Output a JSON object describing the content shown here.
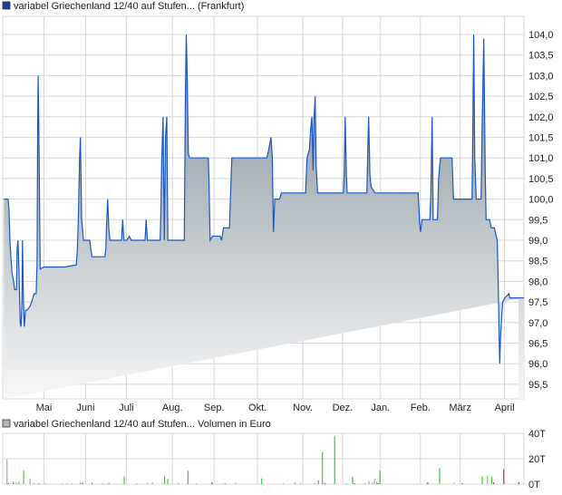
{
  "price_legend": "variabel Griechenland 12/40 auf Stufen... (Frankfurt)",
  "volume_legend": "variabel Griechenland 12/40 auf Stufen... Volumen in Euro",
  "colors": {
    "line": "#1a56c4",
    "fill_top": "#7f8c94",
    "fill_bottom": "#f6f7f8",
    "grid": "#d8d8d8",
    "up": "#33cc33",
    "down": "#e03030",
    "neutral": "#aaaaaa",
    "legend_price": "#1a3c9c",
    "legend_volume": "#b8b8b8"
  },
  "chart_data": [
    {
      "type": "area",
      "title": "variabel Griechenland 12/40 auf Stufen... (Frankfurt)",
      "xunit": "days since start",
      "xlim": [
        0,
        379
      ],
      "ylim": [
        95.1,
        104.45
      ],
      "yticks": [
        "95,5",
        "96,0",
        "96,5",
        "97,0",
        "97,5",
        "98,0",
        "98,5",
        "99,0",
        "99,5",
        "100,0",
        "100,5",
        "101,0",
        "101,5",
        "102,0",
        "102,5",
        "103,0",
        "103,5",
        "104,0"
      ],
      "ytick_values": [
        95.5,
        96,
        96.5,
        97,
        97.5,
        98,
        98.5,
        99,
        99.5,
        100,
        100.5,
        101,
        101.5,
        102,
        102.5,
        103,
        103.5,
        104
      ],
      "months": [
        {
          "label": "Mai",
          "day": 30
        },
        {
          "label": "Juni",
          "day": 60.3
        },
        {
          "label": "Juli",
          "day": 89.9
        },
        {
          "label": "Aug.",
          "day": 123.4
        },
        {
          "label": "Sep.",
          "day": 153.7
        },
        {
          "label": "Okt.",
          "day": 185.3
        },
        {
          "label": "Nov.",
          "day": 218.2
        },
        {
          "label": "Dez.",
          "day": 247.1
        },
        {
          "label": "Jan.",
          "day": 274.7
        },
        {
          "label": "Feb.",
          "day": 303.7
        },
        {
          "label": "März",
          "day": 332.6
        },
        {
          "label": "April",
          "day": 364.9
        }
      ],
      "points": [
        [
          0.8,
          100.0
        ],
        [
          3.9,
          100.0
        ],
        [
          4.6,
          99.7
        ],
        [
          5.2,
          99.0
        ],
        [
          6.1,
          98.5
        ],
        [
          6.8,
          98.2
        ],
        [
          7.9,
          98.0
        ],
        [
          8.7,
          97.8
        ],
        [
          10.0,
          97.8
        ],
        [
          10.5,
          98.8
        ],
        [
          11.1,
          99.0
        ],
        [
          11.8,
          98.3
        ],
        [
          12.7,
          97.0
        ],
        [
          13.3,
          96.9
        ],
        [
          14.0,
          97.5
        ],
        [
          14.4,
          99.0
        ],
        [
          15.1,
          97.5
        ],
        [
          15.7,
          96.9
        ],
        [
          16.6,
          97.3
        ],
        [
          17.7,
          97.3
        ],
        [
          19.9,
          97.4
        ],
        [
          21.0,
          97.5
        ],
        [
          22.8,
          97.7
        ],
        [
          24.3,
          97.7
        ],
        [
          25.0,
          98.5
        ],
        [
          25.4,
          101.5
        ],
        [
          25.8,
          103.0
        ],
        [
          26.5,
          101.0
        ],
        [
          27.2,
          98.3
        ],
        [
          29.8,
          98.35
        ],
        [
          45.1,
          98.35
        ],
        [
          53.5,
          98.4
        ],
        [
          54.3,
          98.8
        ],
        [
          55.2,
          99.8
        ],
        [
          55.9,
          101.0
        ],
        [
          56.5,
          101.5
        ],
        [
          57.4,
          99.5
        ],
        [
          58.7,
          99.0
        ],
        [
          63.3,
          99.0
        ],
        [
          64.0,
          98.8
        ],
        [
          64.9,
          98.6
        ],
        [
          74.3,
          98.6
        ],
        [
          75.0,
          98.8
        ],
        [
          75.4,
          99.3
        ],
        [
          76.3,
          100.0
        ],
        [
          77.1,
          99.3
        ],
        [
          78.0,
          99.0
        ],
        [
          86.4,
          99.0
        ],
        [
          87.2,
          99.5
        ],
        [
          88.1,
          99.0
        ],
        [
          90.3,
          99.0
        ],
        [
          92.1,
          99.1
        ],
        [
          93.4,
          99.0
        ],
        [
          103.5,
          99.0
        ],
        [
          104.3,
          99.5
        ],
        [
          105.2,
          99.0
        ],
        [
          114.4,
          99.0
        ],
        [
          114.9,
          99.5
        ],
        [
          115.7,
          101.0
        ],
        [
          116.6,
          102.0
        ],
        [
          117.5,
          99.0
        ],
        [
          118.4,
          101.5
        ],
        [
          119.3,
          102.0
        ],
        [
          120.1,
          99.0
        ],
        [
          132.0,
          99.0
        ],
        [
          132.9,
          102.7
        ],
        [
          133.5,
          104.0
        ],
        [
          134.2,
          102.9
        ],
        [
          135.0,
          101.1
        ],
        [
          135.9,
          101.0
        ],
        [
          149.5,
          101.0
        ],
        [
          150.0,
          100.4
        ],
        [
          150.8,
          99.0
        ],
        [
          152.6,
          99.1
        ],
        [
          158.1,
          99.1
        ],
        [
          159.2,
          99.0
        ],
        [
          160.5,
          99.3
        ],
        [
          161.8,
          99.3
        ],
        [
          164.9,
          99.3
        ],
        [
          165.3,
          99.8
        ],
        [
          166.6,
          101.0
        ],
        [
          192.1,
          101.0
        ],
        [
          193.4,
          101.2
        ],
        [
          195.1,
          101.5
        ],
        [
          196.0,
          101.0
        ],
        [
          196.5,
          100.0
        ],
        [
          196.9,
          99.2
        ],
        [
          197.8,
          100.0
        ],
        [
          201.3,
          100.0
        ],
        [
          202.6,
          100.15
        ],
        [
          220.2,
          100.15
        ],
        [
          221.3,
          101.0
        ],
        [
          223.0,
          101.2
        ],
        [
          223.9,
          101.7
        ],
        [
          224.8,
          102.0
        ],
        [
          225.7,
          100.7
        ],
        [
          226.3,
          101.9
        ],
        [
          227.2,
          102.5
        ],
        [
          227.9,
          100.8
        ],
        [
          229.0,
          100.15
        ],
        [
          247.7,
          100.15
        ],
        [
          248.3,
          100.6
        ],
        [
          249.0,
          102.0
        ],
        [
          249.9,
          100.6
        ],
        [
          250.5,
          100.15
        ],
        [
          264.8,
          100.15
        ],
        [
          265.7,
          101.5
        ],
        [
          266.1,
          102.0
        ],
        [
          267.0,
          100.6
        ],
        [
          267.9,
          100.3
        ],
        [
          270.7,
          100.15
        ],
        [
          302.1,
          100.15
        ],
        [
          303.2,
          99.4
        ],
        [
          303.8,
          99.2
        ],
        [
          304.9,
          99.5
        ],
        [
          310.6,
          99.5
        ],
        [
          311.3,
          100.1
        ],
        [
          312.2,
          102.0
        ],
        [
          313.0,
          99.5
        ],
        [
          316.1,
          99.5
        ],
        [
          317.0,
          100.5
        ],
        [
          318.3,
          101.0
        ],
        [
          326.7,
          101.0
        ],
        [
          327.8,
          100.0
        ],
        [
          341.2,
          100.0
        ],
        [
          341.6,
          101.0
        ],
        [
          342.5,
          104.0
        ],
        [
          343.2,
          101.0
        ],
        [
          344.3,
          100.0
        ],
        [
          347.8,
          100.0
        ],
        [
          348.7,
          101.9
        ],
        [
          349.8,
          103.9
        ],
        [
          350.9,
          100.5
        ],
        [
          351.5,
          99.5
        ],
        [
          354.0,
          99.5
        ],
        [
          355.3,
          99.3
        ],
        [
          357.5,
          99.3
        ],
        [
          358.8,
          99.1
        ],
        [
          359.6,
          99.0
        ],
        [
          360.3,
          98.0
        ],
        [
          361.0,
          96.6
        ],
        [
          361.4,
          96.0
        ],
        [
          361.9,
          96.6
        ],
        [
          362.7,
          97.1
        ],
        [
          363.6,
          97.5
        ],
        [
          365.1,
          97.6
        ],
        [
          366.7,
          97.65
        ],
        [
          368.0,
          97.7
        ],
        [
          368.8,
          97.6
        ],
        [
          375.0,
          97.6
        ]
      ]
    },
    {
      "type": "bar",
      "title": "Volumen in Euro",
      "xunit": "days since start",
      "xlim": [
        0,
        379
      ],
      "ylim": [
        0,
        40
      ],
      "yticks": [
        "0T",
        "20T",
        "40T"
      ],
      "ytick_values": [
        0,
        20,
        40
      ],
      "bars": [
        [
          2.7,
          19.4,
          "n"
        ],
        [
          3.8,
          0.3,
          "d"
        ],
        [
          7.4,
          2,
          "u"
        ],
        [
          9.5,
          1,
          "u"
        ],
        [
          11.4,
          1.5,
          "u"
        ],
        [
          14.8,
          10.6,
          "u"
        ],
        [
          19.5,
          4.5,
          "n"
        ],
        [
          22.1,
          0.3,
          "u"
        ],
        [
          25.8,
          0.8,
          "u"
        ],
        [
          30.5,
          0.2,
          "n"
        ],
        [
          43.0,
          0.2,
          "n"
        ],
        [
          46.2,
          0.2,
          "n"
        ],
        [
          50.3,
          0.3,
          "n"
        ],
        [
          56.1,
          1,
          "u"
        ],
        [
          57.7,
          1,
          "d"
        ],
        [
          64.5,
          1,
          "d"
        ],
        [
          72.3,
          0.2,
          "n"
        ],
        [
          76.8,
          1,
          "u"
        ],
        [
          88.0,
          6,
          "u"
        ],
        [
          97.1,
          0.2,
          "n"
        ],
        [
          105.0,
          0.3,
          "u"
        ],
        [
          108.4,
          1.5,
          "n"
        ],
        [
          115.5,
          1,
          "n"
        ],
        [
          117.3,
          6,
          "u"
        ],
        [
          119.6,
          4,
          "u"
        ],
        [
          127.2,
          0.5,
          "u"
        ],
        [
          134.3,
          10.6,
          "u"
        ],
        [
          140.3,
          0.3,
          "n"
        ],
        [
          151.8,
          1.5,
          "d"
        ],
        [
          161.2,
          0.3,
          "u"
        ],
        [
          169.1,
          1,
          "n"
        ],
        [
          187.9,
          4.5,
          "u"
        ],
        [
          203.6,
          0.8,
          "n"
        ],
        [
          212.2,
          1.5,
          "n"
        ],
        [
          216.1,
          0.8,
          "n"
        ],
        [
          226.1,
          0.3,
          "u"
        ],
        [
          229.2,
          3,
          "u"
        ],
        [
          232.1,
          25.3,
          "u"
        ],
        [
          233.7,
          0.5,
          "d"
        ],
        [
          241.0,
          37.5,
          "u"
        ],
        [
          249.3,
          0.3,
          "n"
        ],
        [
          254.0,
          5.8,
          "u"
        ],
        [
          255.4,
          0.3,
          "d"
        ],
        [
          263.2,
          1,
          "n"
        ],
        [
          265.8,
          2.5,
          "n"
        ],
        [
          268.4,
          1,
          "n"
        ],
        [
          270.0,
          4.5,
          "n"
        ],
        [
          271.6,
          2,
          "u"
        ],
        [
          272.6,
          0.5,
          "d"
        ],
        [
          273.9,
          10.6,
          "u"
        ],
        [
          308.7,
          1.5,
          "d"
        ],
        [
          317.3,
          12.6,
          "u"
        ],
        [
          327.8,
          1,
          "n"
        ],
        [
          333.8,
          0.5,
          "d"
        ],
        [
          348.2,
          6,
          "u"
        ],
        [
          352.1,
          6.8,
          "n"
        ],
        [
          355.2,
          6,
          "u"
        ],
        [
          356.6,
          1.5,
          "d"
        ],
        [
          363.9,
          11.7,
          "d"
        ],
        [
          374.9,
          1.5,
          "d"
        ]
      ]
    }
  ]
}
